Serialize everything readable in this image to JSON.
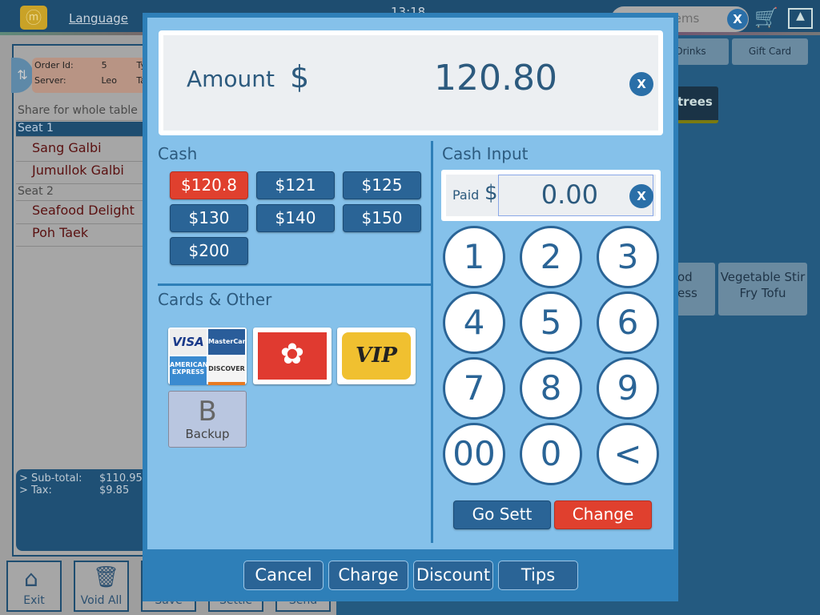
{
  "topbar": {
    "language": "Language",
    "time": "13:18",
    "search_placeholder": "Search Items",
    "search_clear": "X"
  },
  "order": {
    "order_id_label": "Order Id:",
    "order_id": "5",
    "server_label": "Server:",
    "server": "Leo",
    "type_label": "Ty",
    "table_label": "Ta"
  },
  "items": {
    "share": "Share for whole table",
    "seat1": "Seat 1",
    "seat1_items": [
      "Sang Galbi",
      "Jumullok Galbi"
    ],
    "seat2": "Seat 2",
    "seat2_items": [
      "Seafood Delight",
      "Poh Taek"
    ]
  },
  "totals": {
    "subtotal_label": "> Sub-total:",
    "subtotal": "$110.95",
    "tax_label": "> Tax:",
    "tax": "$9.85"
  },
  "bottom_buttons": [
    "Exit",
    "Void All",
    "Save",
    "Settle",
    "Send"
  ],
  "categories": [
    "Drinks",
    "Gift Card"
  ],
  "category_active": "trees",
  "menu_tiles": [
    "od\ness",
    "Vegetable Stir Fry Tofu"
  ],
  "modal": {
    "amount_label": "Amount",
    "currency": "$",
    "amount": "120.80",
    "clear": "X",
    "cash_title": "Cash",
    "cash_options": [
      "$120.8",
      "$121",
      "$125",
      "$130",
      "$140",
      "$150",
      "$200"
    ],
    "cash_selected": "$120.8",
    "cards_title": "Cards & Other",
    "cards": {
      "visa": "VISA",
      "mastercard": "MasterCard",
      "amex": "AMERICAN EXPRESS",
      "discover": "DISCOVER",
      "vip": "VIP",
      "backup_letter": "B",
      "backup": "Backup"
    },
    "cash_input_title": "Cash Input",
    "paid_label": "Paid",
    "paid_currency": "$",
    "paid_value": "0.00",
    "keypad": [
      "1",
      "2",
      "3",
      "4",
      "5",
      "6",
      "7",
      "8",
      "9",
      "00",
      "0",
      "<"
    ],
    "go_sett": "Go Sett",
    "change": "Change",
    "footer": [
      "Cancel",
      "Charge",
      "Discount",
      "Tips"
    ]
  },
  "colors": {
    "accent": "#2a6496",
    "selected": "#e0402e",
    "modal_bg": "#85c1ea"
  }
}
